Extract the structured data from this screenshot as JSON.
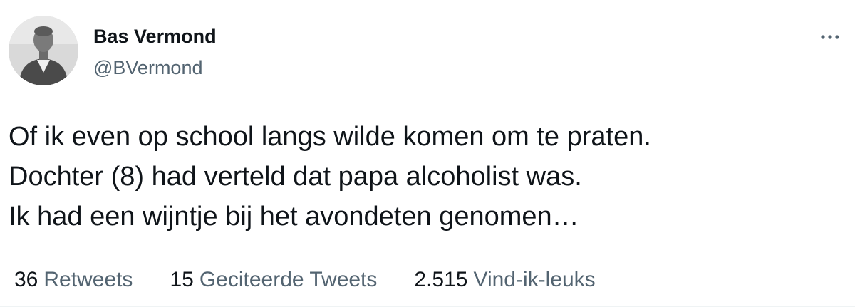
{
  "tweet": {
    "author": {
      "name": "Bas Vermond",
      "handle": "@BVermond"
    },
    "text_lines": [
      "Of ik even op school langs wilde komen om te praten.",
      "Dochter (8) had verteld dat papa alcoholist was.",
      "Ik had een wijntje bij het avondeten genomen…"
    ],
    "stats": [
      {
        "count": "36",
        "label": "Retweets"
      },
      {
        "count": "15",
        "label": "Geciteerde Tweets"
      },
      {
        "count": "2.515",
        "label": "Vind-ik-leuks"
      }
    ],
    "icons": {
      "avatar": "profile-photo",
      "more": "more-horizontal-icon"
    }
  }
}
